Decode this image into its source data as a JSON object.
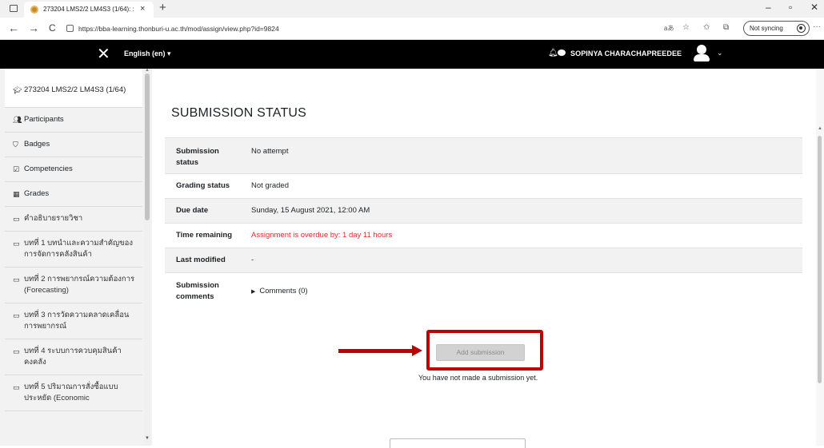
{
  "browser": {
    "tab_title": "273204 LMS2/2 LM4S3 (1/64): :",
    "tab_close": "×",
    "new_tab": "+",
    "url": "https://bba-learning.thonburi-u.ac.th/mod/assign/view.php?id=9824",
    "back": "←",
    "forward": "→",
    "reload": "C",
    "read_aloud": "â",
    "sync_label": "Not syncing",
    "more": "···",
    "minimize": "–",
    "maximize": "▫",
    "close": "✕"
  },
  "navbar": {
    "close_label": "✕",
    "language": "English (en) ▾",
    "username": "SOPINYA CHARACHAPREEDEE",
    "user_caret": "⌄"
  },
  "drawer": {
    "items": [
      {
        "icon": "graduation-cap-icon",
        "label": "273204 LMS2/2 LM4S3 (1/64)"
      },
      {
        "icon": "users-icon",
        "label": "Participants"
      },
      {
        "icon": "shield-icon",
        "label": "Badges"
      },
      {
        "icon": "check-square-icon",
        "label": "Competencies"
      },
      {
        "icon": "table-icon",
        "label": "Grades"
      },
      {
        "icon": "folder-icon",
        "label": "คำอธิบายรายวิชา"
      },
      {
        "icon": "folder-icon",
        "label": "บทที่ 1 บทนำและความสำคัญของการจัดการคลังสินค้า"
      },
      {
        "icon": "folder-icon",
        "label": "บทที่ 2 การพยากรณ์ความต้องการ (Forecasting)"
      },
      {
        "icon": "folder-icon",
        "label": "บทที่ 3 การวัดความคลาดเคลื่อนการพยากรณ์"
      },
      {
        "icon": "folder-icon",
        "label": "บทที่ 4 ระบบการควบคุมสินค้าคงคลัง"
      },
      {
        "icon": "folder-icon",
        "label": "บทที่ 5 ปริมาณการสั่งซื้อแบบประหยัด (Economic"
      }
    ]
  },
  "main": {
    "heading": "SUBMISSION STATUS",
    "rows": [
      {
        "label": "Submission status",
        "value": "No attempt"
      },
      {
        "label": "Grading status",
        "value": "Not graded"
      },
      {
        "label": "Due date",
        "value": "Sunday, 15 August 2021, 12:00 AM"
      },
      {
        "label": "Time remaining",
        "value": "Assignment is overdue by: 1 day 11 hours"
      },
      {
        "label": "Last modified",
        "value": "-"
      },
      {
        "label": "Submission comments",
        "value": "Comments (0)"
      }
    ],
    "add_submission_label": "Add submission",
    "no_submission_text": "You have not made a submission yet.",
    "overdue_color": "#e12b2b",
    "annotation_color": "#c00000"
  }
}
